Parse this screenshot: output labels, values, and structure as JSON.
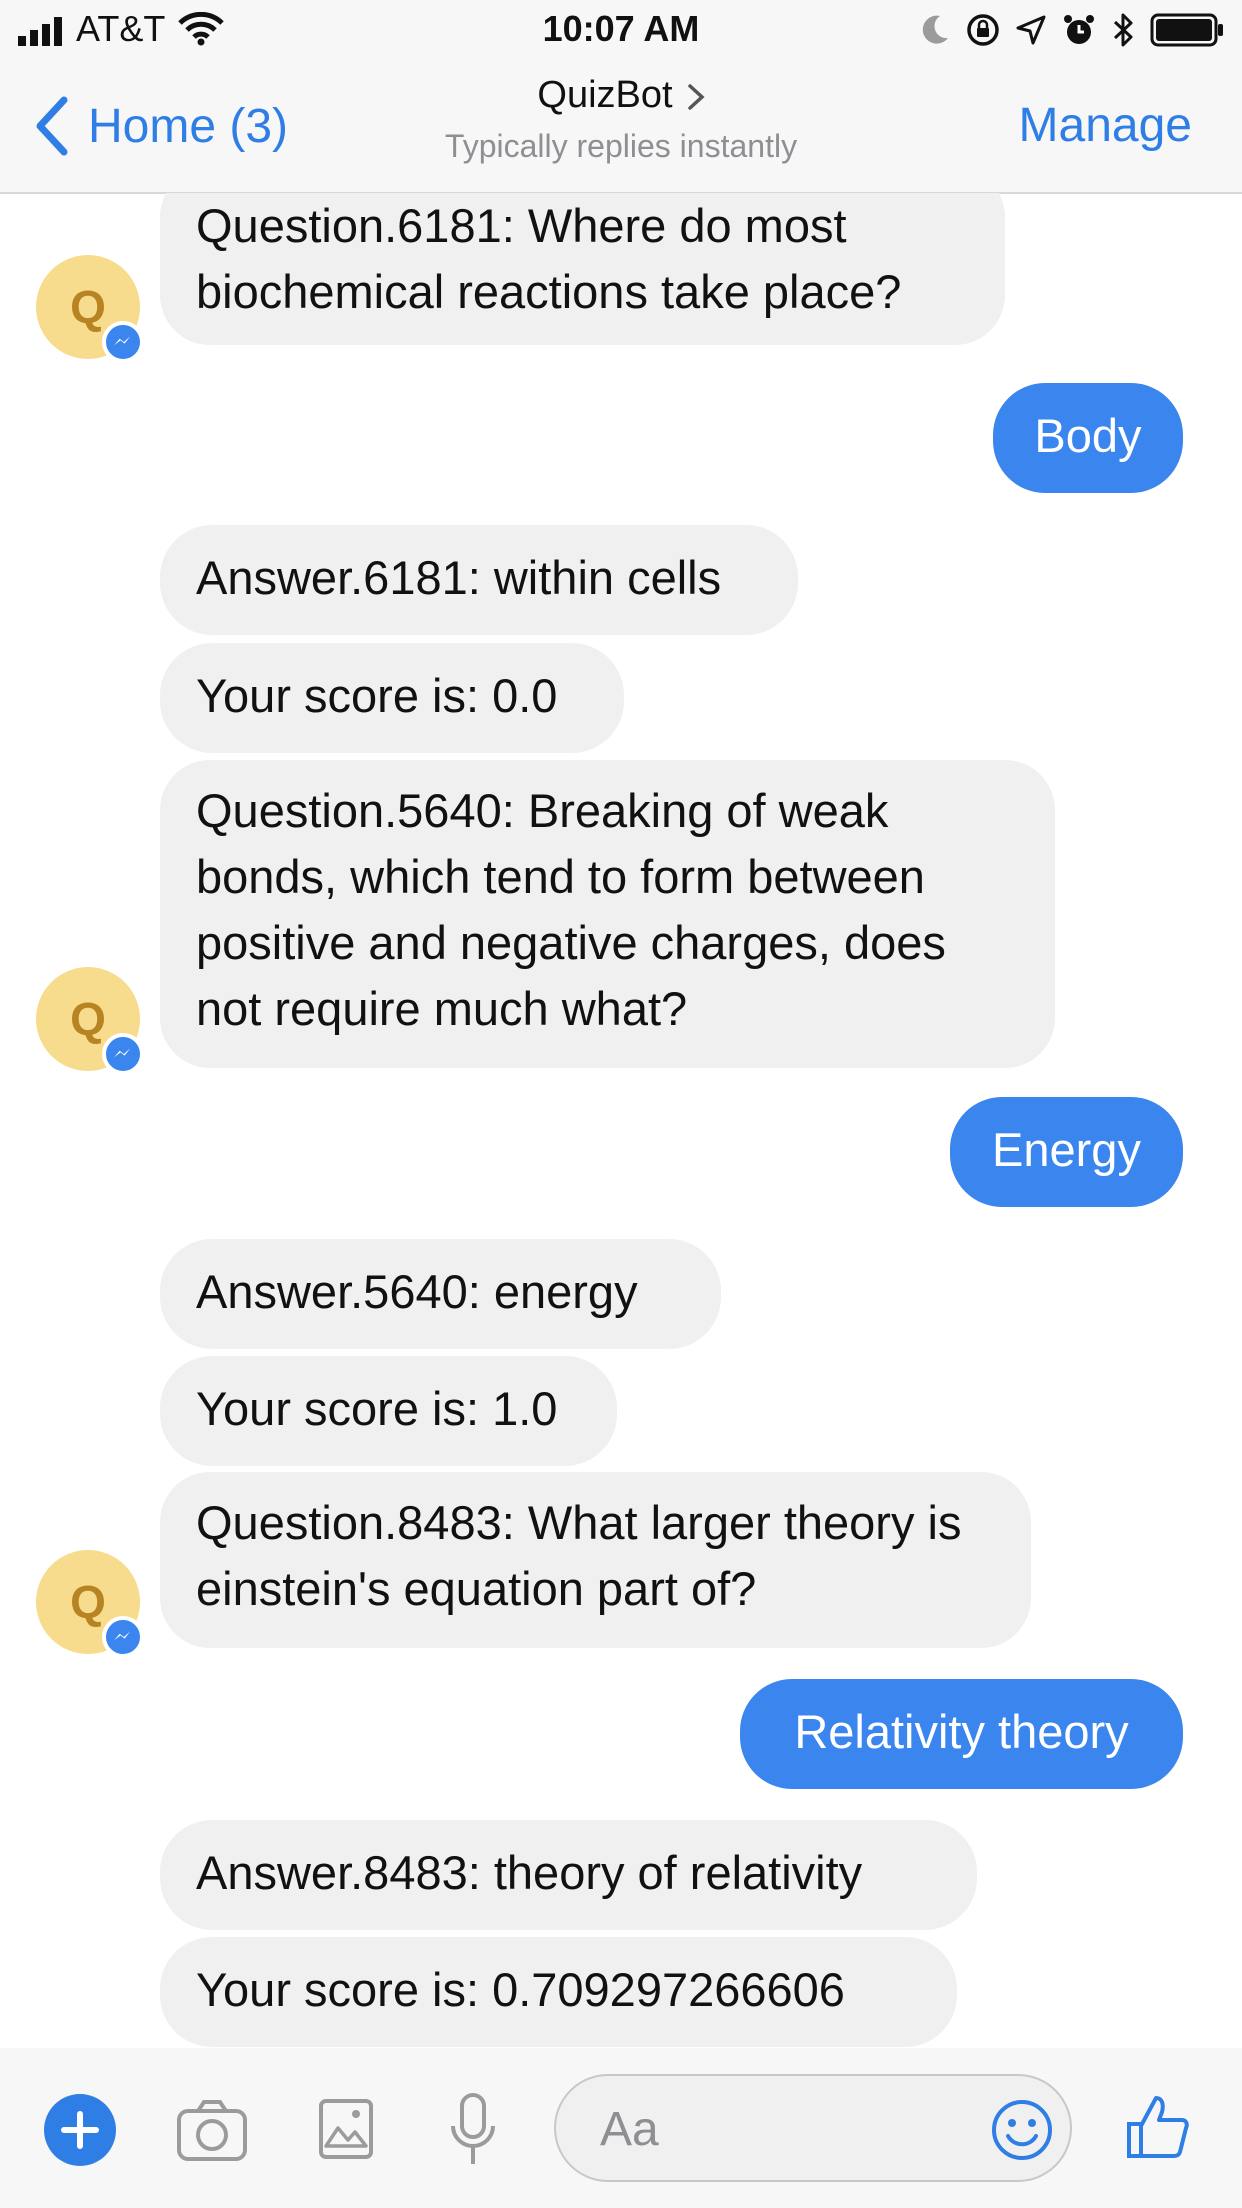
{
  "status_bar": {
    "carrier": "AT&T",
    "time": "10:07 AM"
  },
  "nav": {
    "back_label": "Home (3)",
    "title": "QuizBot",
    "subtitle": "Typically replies instantly",
    "manage_label": "Manage"
  },
  "bot_avatar_letter": "Q",
  "messages": [
    {
      "from": "bot",
      "text": "Question.6181: Where do most biochemical reactions take place?"
    },
    {
      "from": "user",
      "text": "Body"
    },
    {
      "from": "bot",
      "text": "Answer.6181: within cells"
    },
    {
      "from": "bot",
      "text": "Your score is: 0.0"
    },
    {
      "from": "bot",
      "text": "Question.5640: Breaking of weak bonds, which tend to form between positive and negative charges, does not require much what?"
    },
    {
      "from": "user",
      "text": "Energy"
    },
    {
      "from": "bot",
      "text": "Answer.5640: energy"
    },
    {
      "from": "bot",
      "text": "Your score is: 1.0"
    },
    {
      "from": "bot",
      "text": "Question.8483: What larger theory is einstein's equation part of?"
    },
    {
      "from": "user",
      "text": "Relativity theory"
    },
    {
      "from": "bot",
      "text": "Answer.8483: theory of relativity"
    },
    {
      "from": "bot",
      "text": "Your score is: 0.709297266606"
    }
  ],
  "composer": {
    "placeholder": "Aa"
  },
  "colors": {
    "accent": "#2f7ee6",
    "user_bubble": "#3a86ee",
    "bot_bubble": "#f0f0f0",
    "avatar_bg": "#f8dc8e",
    "avatar_letter": "#b88423"
  },
  "icons": [
    "signal-icon",
    "wifi-icon",
    "moon-icon",
    "orientation-lock-icon",
    "location-icon",
    "alarm-icon",
    "bluetooth-icon",
    "battery-icon",
    "back-chevron-icon",
    "title-chevron-icon",
    "messenger-badge-icon",
    "plus-icon",
    "camera-icon",
    "image-icon",
    "microphone-icon",
    "emoji-icon",
    "thumbs-up-icon"
  ]
}
